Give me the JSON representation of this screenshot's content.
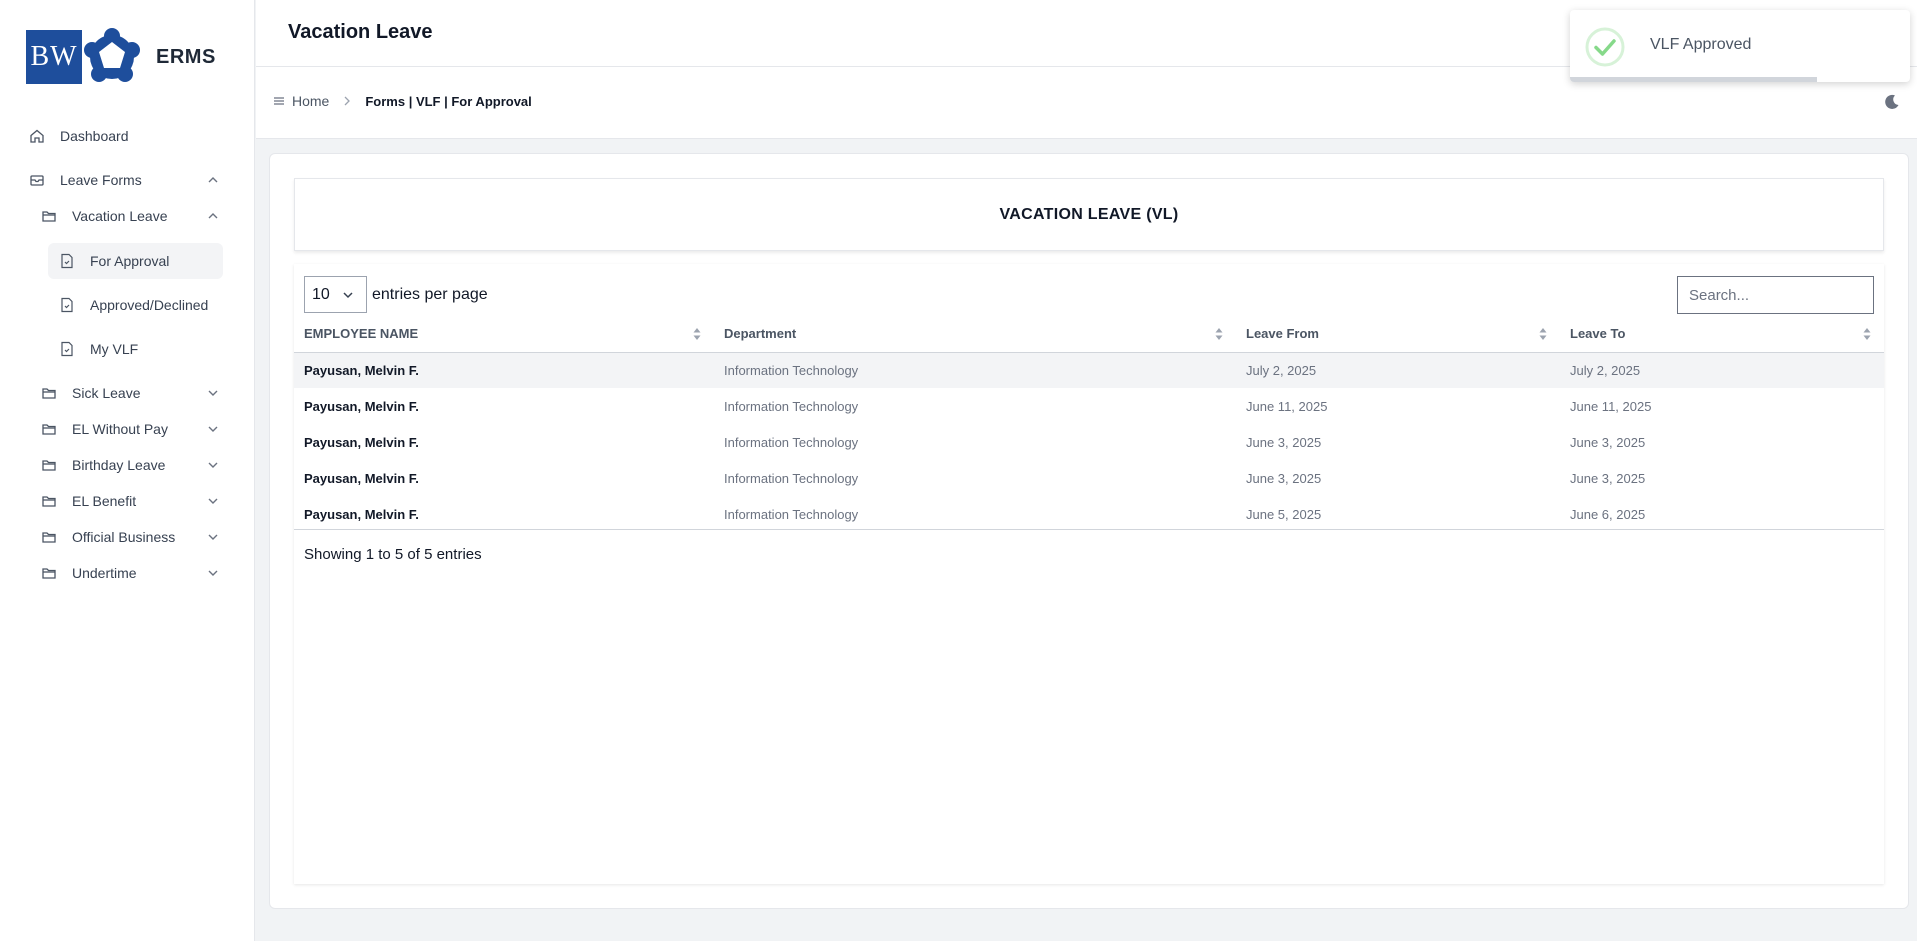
{
  "app": {
    "name": "ERMS",
    "logo_text": "BW"
  },
  "header": {
    "title": "Vacation Leave"
  },
  "breadcrumb": {
    "home": "Home",
    "current": "Forms | VLF | For Approval"
  },
  "sidebar": {
    "dashboard": "Dashboard",
    "leave_forms": "Leave Forms",
    "vacation_leave": "Vacation Leave",
    "for_approval": "For Approval",
    "approved_declined": "Approved/Declined",
    "my_vlf": "My VLF",
    "sick_leave": "Sick Leave",
    "el_without_pay": "EL Without Pay",
    "birthday_leave": "Birthday Leave",
    "el_benefit": "EL Benefit",
    "official_business": "Official Business",
    "undertime": "Undertime"
  },
  "card": {
    "title": "VACATION LEAVE (VL)"
  },
  "table": {
    "page_size": "10",
    "entries_label": "entries per page",
    "search_placeholder": "Search...",
    "columns": [
      "EMPLOYEE NAME",
      "Department",
      "Leave From",
      "Leave To"
    ],
    "rows": [
      [
        "Payusan, Melvin F.",
        "Information Technology",
        "July 2, 2025",
        "July 2, 2025"
      ],
      [
        "Payusan, Melvin F.",
        "Information Technology",
        "June 11, 2025",
        "June 11, 2025"
      ],
      [
        "Payusan, Melvin F.",
        "Information Technology",
        "June 3, 2025",
        "June 3, 2025"
      ],
      [
        "Payusan, Melvin F.",
        "Information Technology",
        "June 3, 2025",
        "June 3, 2025"
      ],
      [
        "Payusan, Melvin F.",
        "Information Technology",
        "June 5, 2025",
        "June 6, 2025"
      ]
    ],
    "showing": "Showing 1 to 5 of 5 entries"
  },
  "toast": {
    "message": "VLF Approved",
    "icon": "check-circle-icon"
  },
  "colors": {
    "brand": "#1e4e9c",
    "success": "#86d98a"
  }
}
